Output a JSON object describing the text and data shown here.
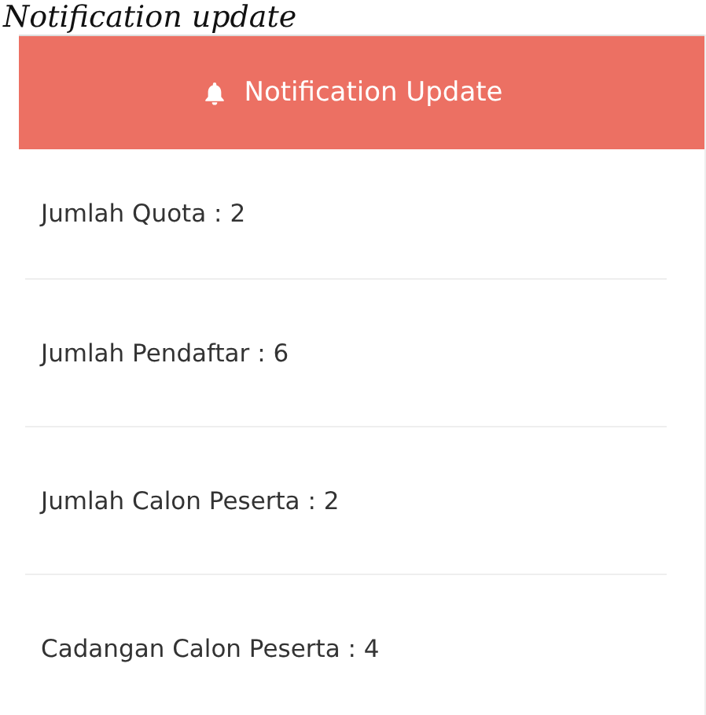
{
  "page_title": "Notification update",
  "panel": {
    "title": "Notification Update"
  },
  "items": [
    {
      "label": "Jumlah Quota : 2"
    },
    {
      "label": "Jumlah Pendaftar : 6"
    },
    {
      "label": "Jumlah Calon Peserta : 2"
    },
    {
      "label": "Cadangan Calon Peserta : 4"
    }
  ]
}
